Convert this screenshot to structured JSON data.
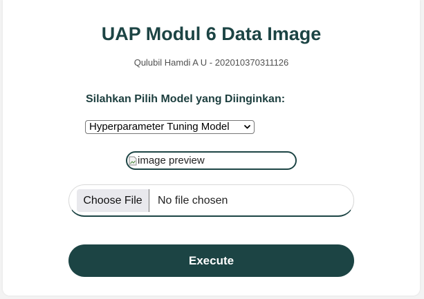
{
  "header": {
    "title": "UAP Modul 6 Data Image",
    "subtitle": "Qulubil Hamdi A U - 202010370311126"
  },
  "form": {
    "model_label": "Silahkan Pilih Model yang Diinginkan:",
    "model_select": {
      "selected": "Hyperparameter Tuning Model"
    },
    "image_preview_alt": "image preview",
    "file_input": {
      "button_label": "Choose File",
      "status": "No file chosen"
    },
    "execute_label": "Execute"
  },
  "colors": {
    "accent": "#1c4444",
    "background": "#f3f3f3",
    "card": "#ffffff"
  },
  "icons": {
    "select_arrow": "chevron-down-icon",
    "preview_broken": "broken-image-icon"
  }
}
